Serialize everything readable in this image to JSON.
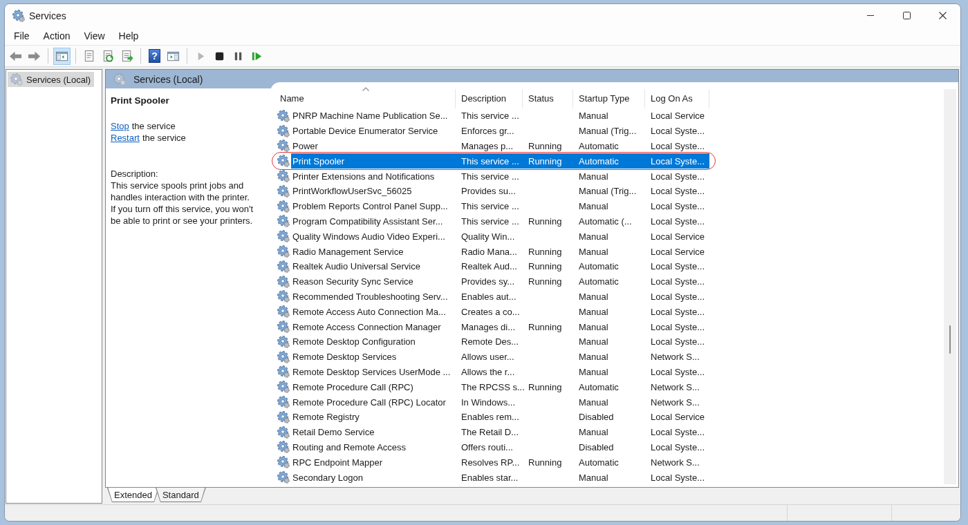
{
  "window": {
    "title": "Services"
  },
  "menu": [
    "File",
    "Action",
    "View",
    "Help"
  ],
  "toolbar": [
    [
      {
        "kind": "back",
        "pressed": false,
        "disabled": false
      },
      {
        "kind": "forward",
        "pressed": false,
        "disabled": false
      }
    ],
    [
      {
        "kind": "console-tree",
        "pressed": true,
        "disabled": false
      }
    ],
    [
      {
        "kind": "properties",
        "pressed": false,
        "disabled": false
      },
      {
        "kind": "refresh",
        "pressed": false,
        "disabled": false
      },
      {
        "kind": "export",
        "pressed": false,
        "disabled": false
      }
    ],
    [
      {
        "kind": "help",
        "glyph": "?",
        "pressed": false,
        "disabled": false
      },
      {
        "kind": "action-pane",
        "pressed": false,
        "disabled": false
      }
    ],
    [
      {
        "kind": "start",
        "pressed": false,
        "disabled": true
      },
      {
        "kind": "stop",
        "pressed": false,
        "disabled": false
      },
      {
        "kind": "pause",
        "pressed": false,
        "disabled": false
      },
      {
        "kind": "resume",
        "pressed": false,
        "disabled": false
      }
    ]
  ],
  "tree": [
    {
      "label": "Services (Local)",
      "selected": true
    }
  ],
  "pane_title": "Services (Local)",
  "detail": {
    "title": "Print Spooler",
    "actions": [
      {
        "link": "Stop",
        "text": "the service"
      },
      {
        "link": "Restart",
        "text": "the service"
      }
    ],
    "description_label": "Description:",
    "description": "This service spools print jobs and handles interaction with the printer. If you turn off this service, you won't be able to print or see your printers."
  },
  "table": {
    "columns": [
      {
        "label": "Name",
        "sorted": true
      },
      {
        "label": "Description",
        "sorted": false
      },
      {
        "label": "Status",
        "sorted": false
      },
      {
        "label": "Startup Type",
        "sorted": false
      },
      {
        "label": "Log On As",
        "sorted": false
      }
    ],
    "rows": [
      {
        "name": "PNRP Machine Name Publication Se...",
        "description": "This service ...",
        "startup_type": "Manual",
        "log_on_as": "Local Service",
        "selected": false,
        "circled": false
      },
      {
        "name": "Portable Device Enumerator Service",
        "description": "Enforces gr...",
        "startup_type": "Manual (Trig...",
        "log_on_as": "Local Syste...",
        "selected": false,
        "circled": false
      },
      {
        "name": "Power",
        "description": "Manages p...",
        "status": "Running",
        "startup_type": "Automatic",
        "log_on_as": "Local Syste...",
        "selected": false,
        "circled": false
      },
      {
        "name": "Print Spooler",
        "description": "This service ...",
        "status": "Running",
        "startup_type": "Automatic",
        "log_on_as": "Local Syste...",
        "selected": true,
        "circled": true
      },
      {
        "name": "Printer Extensions and Notifications",
        "description": "This service ...",
        "startup_type": "Manual",
        "log_on_as": "Local Syste...",
        "selected": false,
        "circled": false
      },
      {
        "name": "PrintWorkflowUserSvc_56025",
        "description": "Provides su...",
        "startup_type": "Manual (Trig...",
        "log_on_as": "Local Syste...",
        "selected": false,
        "circled": false
      },
      {
        "name": "Problem Reports Control Panel Supp...",
        "description": "This service ...",
        "startup_type": "Manual",
        "log_on_as": "Local Syste...",
        "selected": false,
        "circled": false
      },
      {
        "name": "Program Compatibility Assistant Ser...",
        "description": "This service ...",
        "status": "Running",
        "startup_type": "Automatic (...",
        "log_on_as": "Local Syste...",
        "selected": false,
        "circled": false
      },
      {
        "name": "Quality Windows Audio Video Experi...",
        "description": "Quality Win...",
        "startup_type": "Manual",
        "log_on_as": "Local Service",
        "selected": false,
        "circled": false
      },
      {
        "name": "Radio Management Service",
        "description": "Radio Mana...",
        "status": "Running",
        "startup_type": "Manual",
        "log_on_as": "Local Service",
        "selected": false,
        "circled": false
      },
      {
        "name": "Realtek Audio Universal Service",
        "description": "Realtek Aud...",
        "status": "Running",
        "startup_type": "Automatic",
        "log_on_as": "Local Syste...",
        "selected": false,
        "circled": false
      },
      {
        "name": "Reason Security Sync Service",
        "description": "Provides sy...",
        "status": "Running",
        "startup_type": "Automatic",
        "log_on_as": "Local Syste...",
        "selected": false,
        "circled": false
      },
      {
        "name": "Recommended Troubleshooting Serv...",
        "description": "Enables aut...",
        "startup_type": "Manual",
        "log_on_as": "Local Syste...",
        "selected": false,
        "circled": false
      },
      {
        "name": "Remote Access Auto Connection Ma...",
        "description": "Creates a co...",
        "startup_type": "Manual",
        "log_on_as": "Local Syste...",
        "selected": false,
        "circled": false
      },
      {
        "name": "Remote Access Connection Manager",
        "description": "Manages di...",
        "status": "Running",
        "startup_type": "Manual",
        "log_on_as": "Local Syste...",
        "selected": false,
        "circled": false
      },
      {
        "name": "Remote Desktop Configuration",
        "description": "Remote Des...",
        "startup_type": "Manual",
        "log_on_as": "Local Syste...",
        "selected": false,
        "circled": false
      },
      {
        "name": "Remote Desktop Services",
        "description": "Allows user...",
        "startup_type": "Manual",
        "log_on_as": "Network S...",
        "selected": false,
        "circled": false
      },
      {
        "name": "Remote Desktop Services UserMode ...",
        "description": "Allows the r...",
        "startup_type": "Manual",
        "log_on_as": "Local Syste...",
        "selected": false,
        "circled": false
      },
      {
        "name": "Remote Procedure Call (RPC)",
        "description": "The RPCSS s...",
        "status": "Running",
        "startup_type": "Automatic",
        "log_on_as": "Network S...",
        "selected": false,
        "circled": false
      },
      {
        "name": "Remote Procedure Call (RPC) Locator",
        "description": "In Windows...",
        "startup_type": "Manual",
        "log_on_as": "Network S...",
        "selected": false,
        "circled": false
      },
      {
        "name": "Remote Registry",
        "description": "Enables rem...",
        "startup_type": "Disabled",
        "log_on_as": "Local Service",
        "selected": false,
        "circled": false
      },
      {
        "name": "Retail Demo Service",
        "description": "The Retail D...",
        "startup_type": "Manual",
        "log_on_as": "Local Syste...",
        "selected": false,
        "circled": false
      },
      {
        "name": "Routing and Remote Access",
        "description": "Offers routi...",
        "startup_type": "Disabled",
        "log_on_as": "Local Syste...",
        "selected": false,
        "circled": false
      },
      {
        "name": "RPC Endpoint Mapper",
        "description": "Resolves RP...",
        "status": "Running",
        "startup_type": "Automatic",
        "log_on_as": "Network S...",
        "selected": false,
        "circled": false
      },
      {
        "name": "Secondary Logon",
        "description": "Enables star...",
        "startup_type": "Manual",
        "log_on_as": "Local Syste...",
        "selected": false,
        "circled": false
      }
    ]
  },
  "view_tabs": [
    {
      "label": "Extended",
      "selected": true
    },
    {
      "label": "Standard",
      "selected": false
    }
  ]
}
